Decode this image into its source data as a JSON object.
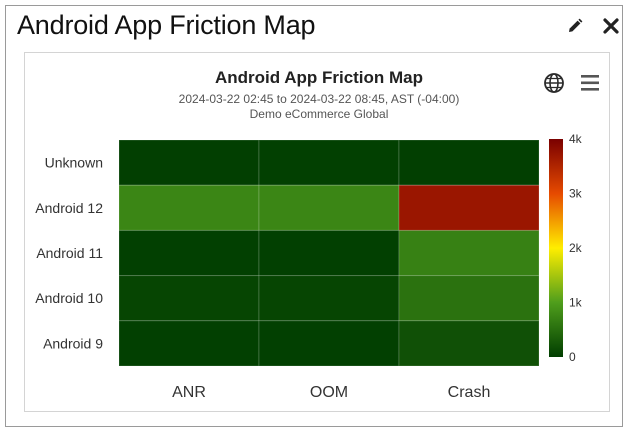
{
  "widget": {
    "title": "Android App Friction Map",
    "edit_icon": "pencil-icon",
    "close_icon": "close-icon"
  },
  "toolbar": {
    "globe_icon": "globe-icon",
    "menu_icon": "hamburger-menu-icon"
  },
  "chart_data": {
    "type": "heatmap",
    "title": "Android App Friction Map",
    "subtitle_lines": [
      "2024-03-22 02:45 to 2024-03-22 08:45, AST (-04:00)",
      "Demo eCommerce Global"
    ],
    "x_categories": [
      "ANR",
      "OOM",
      "Crash"
    ],
    "y_categories": [
      "Unknown",
      "Android 12",
      "Android 11",
      "Android 10",
      "Android 9"
    ],
    "values": [
      [
        20,
        30,
        20
      ],
      [
        750,
        750,
        3700
      ],
      [
        30,
        30,
        700
      ],
      [
        80,
        80,
        550
      ],
      [
        30,
        30,
        200
      ]
    ],
    "color_axis": {
      "min": 0,
      "max": 4000,
      "ticks": [
        "0",
        "1k",
        "2k",
        "3k",
        "4k"
      ],
      "stops": [
        [
          0,
          "#003d00"
        ],
        [
          0.25,
          "#4f9e1c"
        ],
        [
          0.5,
          "#ffee00"
        ],
        [
          0.75,
          "#e64a00"
        ],
        [
          1,
          "#7a0000"
        ]
      ]
    },
    "grid": true,
    "legend": "right"
  }
}
